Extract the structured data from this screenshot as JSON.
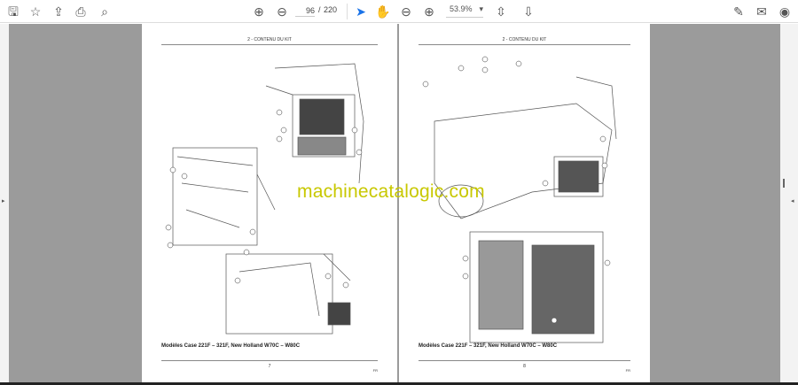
{
  "toolbar": {
    "save": "save-icon",
    "bookmark": "star-icon",
    "upload": "upload-icon",
    "print": "print-icon",
    "find": "search-icon",
    "prev": "arrow-up-icon",
    "next": "arrow-down-icon",
    "current_page": "96",
    "page_sep": "/",
    "total_pages": "220",
    "select": "cursor-icon",
    "hand": "hand-icon",
    "zoom_out": "zoom-out-icon",
    "zoom_in": "zoom-in-icon",
    "zoom_level": "53.9%",
    "fit": "fit-page-icon",
    "scroll": "scroll-mode-icon",
    "sign": "sign-icon",
    "email": "email-icon",
    "account": "account-icon"
  },
  "pages": [
    {
      "header": "2 - CONTENU DU KIT",
      "caption": "Modèles Case 221F – 321F, New Holland W70C – W80C",
      "number": "7",
      "lang": "FR"
    },
    {
      "header": "2 - CONTENU DU KIT",
      "caption": "Modèles Case 221F – 321F, New Holland W70C – W80C",
      "number": "8",
      "lang": "FR"
    }
  ],
  "watermark": "machinecatalogic.com"
}
